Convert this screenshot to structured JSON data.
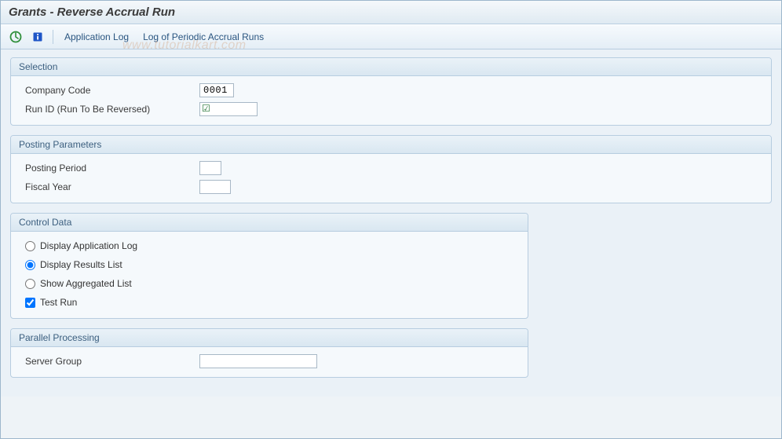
{
  "window": {
    "title": "Grants - Reverse Accrual Run"
  },
  "toolbar": {
    "app_log_label": "Application Log",
    "periodic_log_label": "Log of Periodic Accrual Runs"
  },
  "groups": {
    "selection": {
      "title": "Selection",
      "company_code_label": "Company Code",
      "company_code_value": "0001",
      "run_id_label": "Run ID (Run To Be Reversed)",
      "run_id_value": ""
    },
    "posting": {
      "title": "Posting Parameters",
      "posting_period_label": "Posting Period",
      "posting_period_value": "",
      "fiscal_year_label": "Fiscal Year",
      "fiscal_year_value": ""
    },
    "control": {
      "title": "Control Data",
      "radio_app_log": "Display Application Log",
      "radio_results": "Display Results List",
      "radio_aggregated": "Show Aggregated List",
      "check_test_run": "Test Run"
    },
    "parallel": {
      "title": "Parallel Processing",
      "server_group_label": "Server Group",
      "server_group_value": ""
    }
  },
  "watermark": "www.tutorialkart.com"
}
